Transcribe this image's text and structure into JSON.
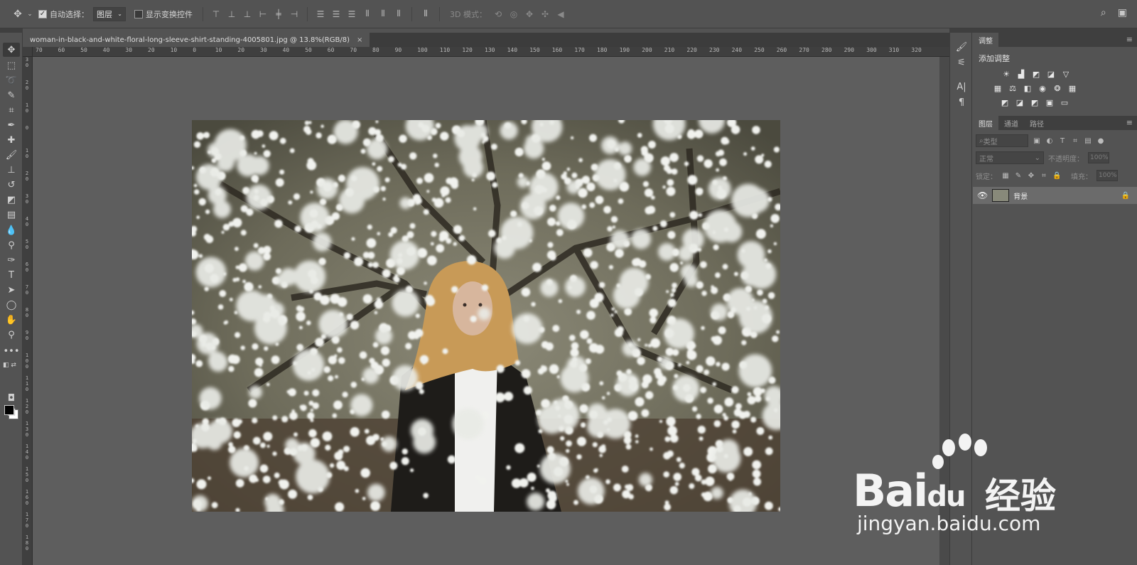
{
  "options_bar": {
    "auto_select_label": "自动选择：",
    "auto_select_checked": true,
    "auto_select_target": "图层",
    "show_transform_label": "显示变换控件",
    "show_transform_checked": false,
    "mode_3d_label": "3D 模式："
  },
  "document": {
    "tab_title": "woman-in-black-and-white-floral-long-sleeve-shirt-standing-4005801.jpg @ 13.8%(RGB/8)",
    "close_glyph": "×"
  },
  "ruler": {
    "h_labels": [
      "70",
      "60",
      "50",
      "40",
      "30",
      "20",
      "10",
      "0",
      "10",
      "20",
      "30",
      "40",
      "50",
      "60",
      "70",
      "80",
      "90",
      "100",
      "110",
      "120",
      "130",
      "140",
      "150",
      "160",
      "170",
      "180",
      "190",
      "200",
      "210",
      "220",
      "230",
      "240",
      "250",
      "260",
      "270",
      "280",
      "290",
      "300",
      "310",
      "320"
    ],
    "v_labels": [
      "3 0",
      "2 0",
      "1 0",
      "0",
      "1 0",
      "2 0",
      "3 0",
      "4 0",
      "5 0",
      "6 0",
      "7 0",
      "8 0",
      "9 0",
      "1 0 0",
      "1 1 0",
      "1 2 0",
      "1 3 0",
      "1 4 0",
      "1 5 0",
      "1 6 0",
      "1 7 0",
      "1 8 0"
    ]
  },
  "adjustments_panel": {
    "tab": "调整",
    "title": "添加调整"
  },
  "layers_panel": {
    "tabs": [
      "图层",
      "通道",
      "路径"
    ],
    "filter_placeholder": "类型",
    "blend_mode": "正常",
    "opacity_label": "不透明度：",
    "opacity_value": "100%",
    "lock_label": "锁定：",
    "fill_label": "填充：",
    "fill_value": "100%",
    "layer_name": "背景"
  },
  "watermark": {
    "logo": "Bai",
    "logo_suffix": "du",
    "cn": "经验",
    "url": "jingyan.baidu.com"
  },
  "colors": {
    "foreground": "#000000",
    "background": "#ffffff"
  }
}
